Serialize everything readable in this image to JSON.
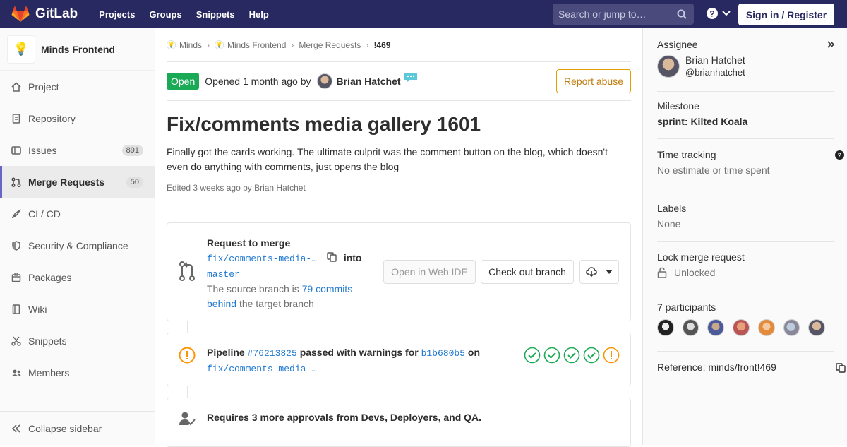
{
  "topbar": {
    "brand": "GitLab",
    "nav": [
      "Projects",
      "Groups",
      "Snippets",
      "Help"
    ],
    "search_placeholder": "Search or jump to…",
    "signin": "Sign in / Register"
  },
  "sidebar": {
    "project_name": "Minds Frontend",
    "items": [
      {
        "label": "Project",
        "icon": "home-icon"
      },
      {
        "label": "Repository",
        "icon": "doc-icon"
      },
      {
        "label": "Issues",
        "icon": "issues-icon",
        "count": "891"
      },
      {
        "label": "Merge Requests",
        "icon": "merge-request-icon",
        "count": "50",
        "active": true
      },
      {
        "label": "CI / CD",
        "icon": "rocket-icon"
      },
      {
        "label": "Security & Compliance",
        "icon": "shield-icon"
      },
      {
        "label": "Packages",
        "icon": "package-icon"
      },
      {
        "label": "Wiki",
        "icon": "book-icon"
      },
      {
        "label": "Snippets",
        "icon": "scissors-icon"
      },
      {
        "label": "Members",
        "icon": "users-icon"
      }
    ],
    "collapse": "Collapse sidebar"
  },
  "breadcrumb": {
    "items": [
      "Minds",
      "Minds Frontend",
      "Merge Requests"
    ],
    "current": "!469"
  },
  "mr": {
    "status": "Open",
    "opened_prefix": "Opened",
    "opened_time": "1 month ago",
    "by": "by",
    "author": "Brian Hatchet",
    "report": "Report abuse",
    "title": "Fix/comments media gallery 1601",
    "description": "Finally got the cards working. The ultimate culprit was the comment button on the blog, which doesn't even do anything with comments, just opens the blog",
    "edited": "Edited 3 weeks ago by Brian Hatchet"
  },
  "merge_widget": {
    "heading": "Request to merge",
    "source_branch": "fix/comments-media-…",
    "into": "into",
    "target_branch": "master",
    "behind_prefix": "The source branch is",
    "behind_link_1": "79 commits",
    "behind_link_2": "behind",
    "behind_suffix": "the target branch",
    "open_ide": "Open in Web IDE",
    "checkout": "Check out branch"
  },
  "pipeline": {
    "label": "Pipeline",
    "id": "#76213825",
    "status": "passed with warnings for",
    "commit": "b1b680b5",
    "on": "on",
    "branch": "fix/comments-media-…",
    "stages": [
      "success",
      "success",
      "success",
      "success",
      "warning"
    ]
  },
  "approvals": {
    "text": "Requires 3 more approvals from Devs, Deployers, and QA."
  },
  "right": {
    "assignee_label": "Assignee",
    "assignee_name": "Brian Hatchet",
    "assignee_user": "@brianhatchet",
    "milestone_label": "Milestone",
    "milestone_value": "sprint: Kilted Koala",
    "time_label": "Time tracking",
    "time_value": "No estimate or time spent",
    "labels_label": "Labels",
    "labels_value": "None",
    "lock_label": "Lock merge request",
    "lock_value": "Unlocked",
    "participants_label": "7 participants",
    "reference": "Reference: minds/front!469"
  },
  "colors": {
    "navbar": "#292961",
    "open_badge": "#1aaa55",
    "link": "#1f78d1",
    "success": "#1aaa55",
    "warning": "#fc9403"
  }
}
